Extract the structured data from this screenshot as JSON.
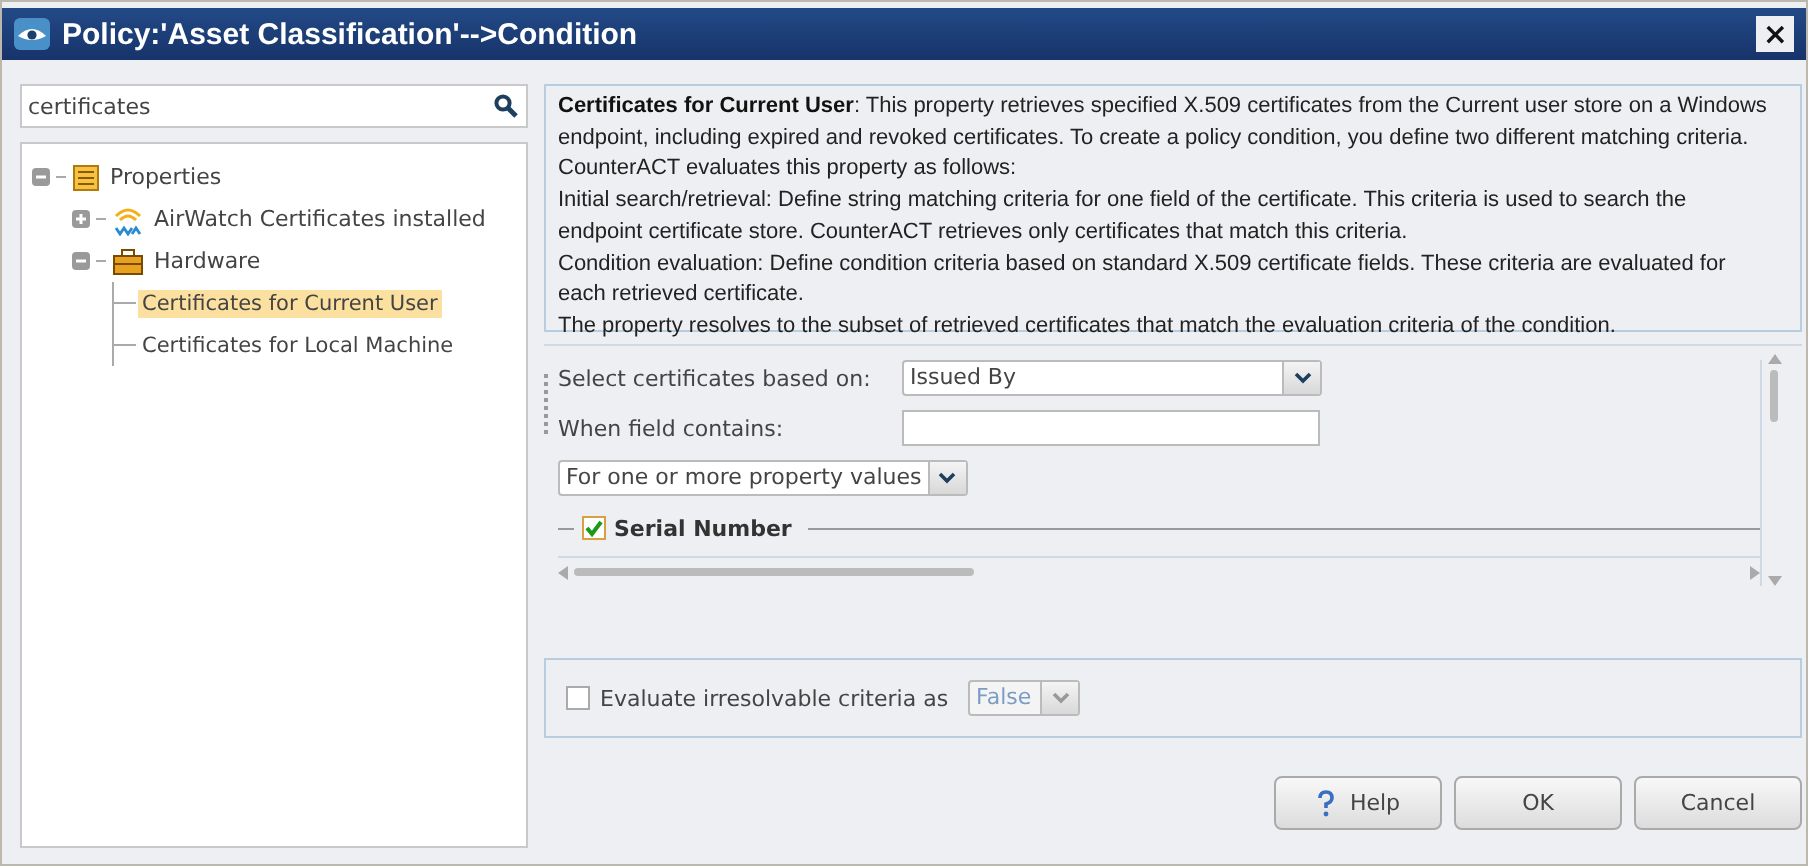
{
  "window": {
    "title": "Policy:'Asset Classification'-->Condition",
    "close": "×"
  },
  "search": {
    "value": "certificates"
  },
  "tree": [
    {
      "label": "Properties",
      "expanded": true,
      "children": [
        {
          "label": "AirWatch Certificates installed",
          "expanded": false
        },
        {
          "label": "Hardware",
          "expanded": true,
          "children": [
            {
              "label": "Certificates for Current User",
              "selected": true
            },
            {
              "label": "Certificates for Local Machine",
              "selected": false
            }
          ]
        }
      ]
    }
  ],
  "description": [
    "**Certificates for Current User**: This property retrieves specified X.509 certificates from the Current user store on a Windows endpoint, including expired and revoked certificates. To create a policy condition, you define two different matching criteria. CounterACT evaluates this property as follows:",
    "Initial search/retrieval: Define string matching criteria for one field of the certificate. This criteria is used to search the endpoint certificate store. CounterACT retrieves only certificates that match this criteria.",
    "Condition evaluation: Define condition criteria based on standard X.509 certificate fields. These criteria are evaluated for each retrieved certificate.",
    "The property resolves to the subset of retrieved certificates that match the evaluation criteria of the condition."
  ],
  "form": {
    "select_label": "Select certificates based on:",
    "select_value": "Issued By",
    "contains_label": "When field contains:",
    "mode_value": "For one or more property values",
    "group": {
      "label": "Serial Number",
      "checked": true
    }
  },
  "evaluate": {
    "label": "Evaluate irresolvable criteria as",
    "checked": false,
    "value": "False",
    "disabled": true
  },
  "buttons": [
    {
      "label": "Help",
      "kind": "help"
    },
    {
      "label": "OK",
      "kind": "plain"
    },
    {
      "label": "Cancel",
      "kind": "plain"
    }
  ]
}
